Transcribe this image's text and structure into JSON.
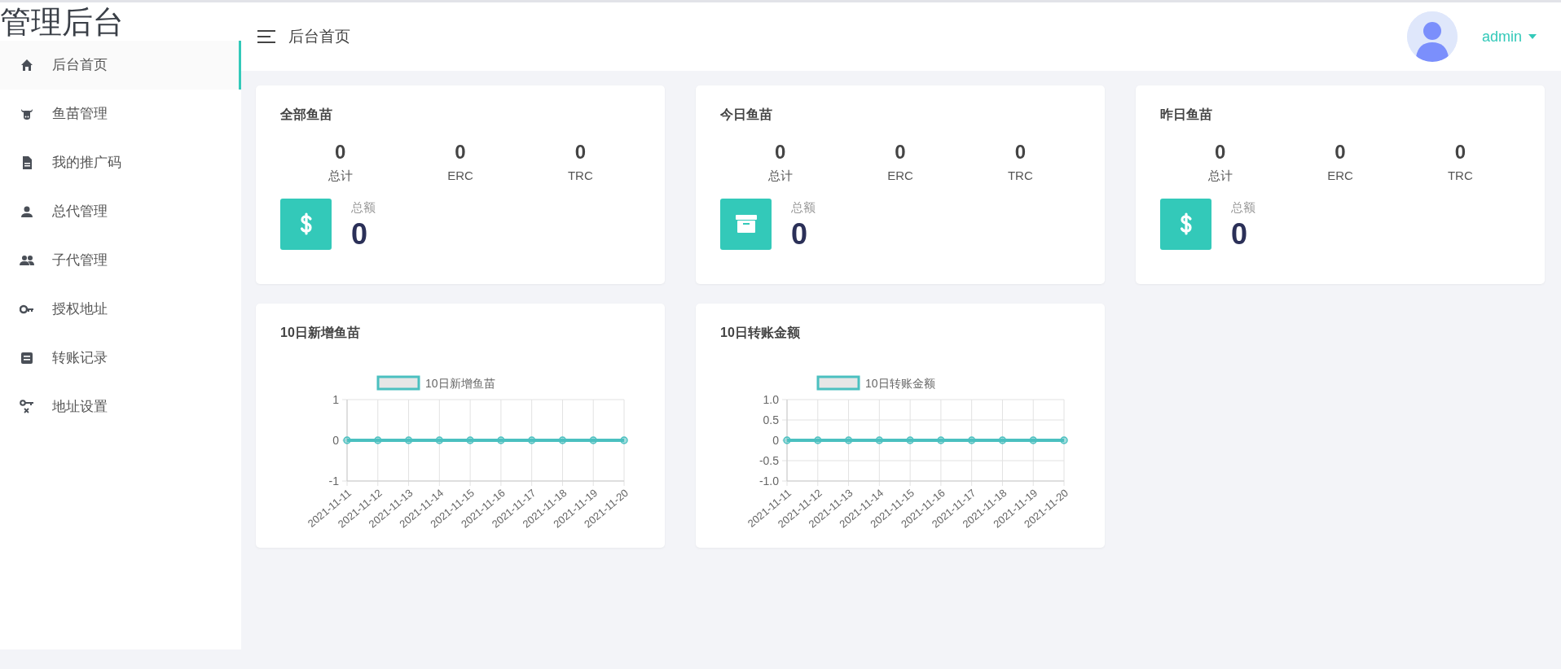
{
  "sidebar": {
    "logo": "管理后台",
    "items": [
      {
        "label": "后台首页",
        "kind": "home",
        "selected": true
      },
      {
        "label": "鱼苗管理",
        "kind": "cow",
        "selected": false
      },
      {
        "label": "我的推广码",
        "kind": "file",
        "selected": false
      },
      {
        "label": "总代管理",
        "kind": "user",
        "selected": false
      },
      {
        "label": "子代管理",
        "kind": "users",
        "selected": false
      },
      {
        "label": "授权地址",
        "kind": "key",
        "selected": false
      },
      {
        "label": "转账记录",
        "kind": "list",
        "selected": false
      },
      {
        "label": "地址设置",
        "kind": "keyx",
        "selected": false
      }
    ]
  },
  "header": {
    "title": "后台首页",
    "username": "admin"
  },
  "stat_cards": [
    {
      "title": "全部鱼苗",
      "kind": "dollar",
      "stats": [
        {
          "value": "0",
          "label": "总计"
        },
        {
          "value": "0",
          "label": "ERC"
        },
        {
          "value": "0",
          "label": "TRC"
        }
      ],
      "total_label": "总额",
      "total_value": "0"
    },
    {
      "title": "今日鱼苗",
      "kind": "archive",
      "stats": [
        {
          "value": "0",
          "label": "总计"
        },
        {
          "value": "0",
          "label": "ERC"
        },
        {
          "value": "0",
          "label": "TRC"
        }
      ],
      "total_label": "总额",
      "total_value": "0"
    },
    {
      "title": "昨日鱼苗",
      "kind": "dollar",
      "stats": [
        {
          "value": "0",
          "label": "总计"
        },
        {
          "value": "0",
          "label": "ERC"
        },
        {
          "value": "0",
          "label": "TRC"
        }
      ],
      "total_label": "总额",
      "total_value": "0"
    }
  ],
  "chart_cards": [
    {
      "title": "10日新增鱼苗",
      "chart_data": {
        "type": "line",
        "categories": [
          "2021-11-11",
          "2021-11-12",
          "2021-11-13",
          "2021-11-14",
          "2021-11-15",
          "2021-11-16",
          "2021-11-17",
          "2021-11-18",
          "2021-11-19",
          "2021-11-20"
        ],
        "series": [
          {
            "name": "10日新增鱼苗",
            "color": "#4bc0c0",
            "marker": "circle",
            "values": [
              0,
              0,
              0,
              0,
              0,
              0,
              0,
              0,
              0,
              0
            ]
          }
        ],
        "ylim": [
          -1,
          1
        ],
        "yticks": [
          1,
          0,
          -1
        ],
        "grid": true
      }
    },
    {
      "title": "10日转账金额",
      "chart_data": {
        "type": "line",
        "categories": [
          "2021-11-11",
          "2021-11-12",
          "2021-11-13",
          "2021-11-14",
          "2021-11-15",
          "2021-11-16",
          "2021-11-17",
          "2021-11-18",
          "2021-11-19",
          "2021-11-20"
        ],
        "series": [
          {
            "name": "10日转账金额",
            "color": "#4bc0c0",
            "marker": "circle",
            "values": [
              0,
              0,
              0,
              0,
              0,
              0,
              0,
              0,
              0,
              0
            ]
          }
        ],
        "ylim": [
          -1,
          1
        ],
        "yticks": [
          {
            "value": 1,
            "label": "1.0"
          },
          {
            "value": 0.5,
            "label": "0.5"
          },
          0,
          {
            "value": -0.5,
            "label": "-0.5"
          },
          {
            "value": -1,
            "label": "-1.0"
          }
        ],
        "grid": true
      }
    }
  ]
}
